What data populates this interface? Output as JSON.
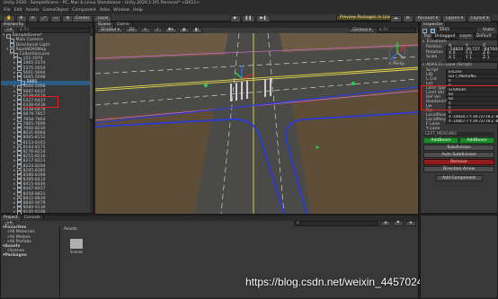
{
  "window": {
    "title": "Unity 2020 - SampleScene - PC, Mac & Linux Standalone - Unity 2020.1.0f1 Personal* <DX11>"
  },
  "menu": [
    "File",
    "Edit",
    "Assets",
    "GameObject",
    "Component",
    "Adas",
    "Window",
    "Help"
  ],
  "toolbar": {
    "pivot": "Center",
    "space": "Local",
    "preview_packages": "Preview Packages In Use",
    "account": "Account",
    "layers": "Layers",
    "layout": "Layout"
  },
  "hierarchy": {
    "tab": "Hierarchy",
    "search_placeholder": "All",
    "items": [
      {
        "label": "SampleScene*",
        "indent": 0,
        "open": true
      },
      {
        "label": "Main Camera",
        "indent": 1
      },
      {
        "label": "Directional Light",
        "indent": 1
      },
      {
        "label": "RoadADASMap",
        "indent": 1,
        "open": true
      },
      {
        "label": "CollectionLane",
        "indent": 2,
        "open": true
      },
      {
        "label": "151-1974",
        "indent": 3
      },
      {
        "label": "1965-5374",
        "indent": 3
      },
      {
        "label": "5375-5659",
        "indent": 3
      },
      {
        "label": "5661-5664",
        "indent": 3
      },
      {
        "label": "5665-5698",
        "indent": 3
      },
      {
        "label": "5665",
        "indent": 4,
        "selected": true
      },
      {
        "label": "5666-5668",
        "indent": 3
      },
      {
        "label": "5687-6037",
        "indent": 3
      },
      {
        "label": "6038-6426",
        "indent": 3
      },
      {
        "label": "6427-6437",
        "indent": 3
      },
      {
        "label": "6438-6438",
        "indent": 3
      },
      {
        "label": "6438-6878",
        "indent": 3
      },
      {
        "label": "6879-7857",
        "indent": 3
      },
      {
        "label": "7858-7864",
        "indent": 3
      },
      {
        "label": "7865-7899",
        "indent": 3
      },
      {
        "label": "7900-8030",
        "indent": 3
      },
      {
        "label": "8031-8064",
        "indent": 3
      },
      {
        "label": "8065-8152",
        "indent": 3
      },
      {
        "label": "8153-8163",
        "indent": 3
      },
      {
        "label": "8164-8175",
        "indent": 3
      },
      {
        "label": "8176-8214",
        "indent": 3
      },
      {
        "label": "8215-8216",
        "indent": 3
      },
      {
        "label": "8217-8223",
        "indent": 3
      },
      {
        "label": "8224-8294",
        "indent": 3
      },
      {
        "label": "8295-8385",
        "indent": 3
      },
      {
        "label": "8386-8398",
        "indent": 3
      },
      {
        "label": "8399-8414",
        "indent": 3
      },
      {
        "label": "8415-8446",
        "indent": 3
      },
      {
        "label": "8447-8457",
        "indent": 3
      },
      {
        "label": "8458-8821",
        "indent": 3
      },
      {
        "label": "8822-8839",
        "indent": 3
      },
      {
        "label": "8840-9079",
        "indent": 3
      },
      {
        "label": "9080-9139",
        "indent": 3
      },
      {
        "label": "9140-9198",
        "indent": 3
      }
    ]
  },
  "scene": {
    "tabs": [
      "Scene",
      "Game"
    ],
    "shading": "Shaded",
    "mode_2d": "2D",
    "gizmos": "Gizmos",
    "search_placeholder": "All",
    "projection": "< Persp"
  },
  "inspector": {
    "tab": "Inspector",
    "object_name": "5665",
    "static_label": "Static",
    "tag_label": "Tag",
    "tag_value": "Untagged",
    "layer_label": "Layer",
    "layer_value": "Default",
    "transform": {
      "title": "Transform",
      "rows": [
        {
          "label": "Position",
          "x": "-14820",
          "y": "39.7279",
          "z": "-84700"
        },
        {
          "label": "Rotation",
          "x": "0",
          "y": "0",
          "z": "0"
        },
        {
          "label": "Scale",
          "x": "1",
          "y": "1",
          "z": "1"
        }
      ]
    },
    "lane_component": {
      "title": "ADAS En Lane (Script)",
      "fields": [
        {
          "label": "Script",
          "value": "EnLane"
        },
        {
          "label": "LID",
          "value": "LEFT_MERGING"
        },
        {
          "label": "L Cnt",
          "value": "0"
        },
        {
          "label": "Lnt",
          "value": "0"
        },
        {
          "label": "Lane Type",
          "value": "STRAIGHT"
        },
        {
          "label": "Limit Vel",
          "value": "60"
        },
        {
          "label": "Ref Vel",
          "value": "60"
        },
        {
          "label": "Roadsecid",
          "value": "0"
        },
        {
          "label": "Lw",
          "value": "0"
        },
        {
          "label": "Rw",
          "value": "0"
        },
        {
          "label": "LocalPosx",
          "value": "X -14820.7   Y 39.72778   Z -84700.3"
        },
        {
          "label": "LocalPosy",
          "value": "X -14807.7   Y 39.72778   Z -84700.3"
        },
        {
          "label": "F Lane",
          "value": ""
        },
        {
          "label": "Y Lane",
          "value": ""
        }
      ],
      "list_header": "LEFT_MERGING",
      "buttons": {
        "left": "AddBeam",
        "right": "AddBeam",
        "subdivision": "Subdivision",
        "auto_subdivision": "Auto Subdivision",
        "delete": "Remove",
        "direction": "Direction Arrow"
      }
    },
    "add_component": "Add Component"
  },
  "project": {
    "tabs": [
      "Project",
      "Console"
    ],
    "tree": [
      {
        "label": "Favorites",
        "indent": 0,
        "bold": true
      },
      {
        "label": "All Materials",
        "indent": 1
      },
      {
        "label": "All Models",
        "indent": 1
      },
      {
        "label": "All Prefabs",
        "indent": 1
      },
      {
        "label": "Assets",
        "indent": 0,
        "bold": true
      },
      {
        "label": "Scenes",
        "indent": 1
      },
      {
        "label": "Packages",
        "indent": 0,
        "bold": true
      }
    ],
    "breadcrumb": "Assets",
    "folder": "Scenes"
  },
  "watermark": "https://blog.csdn.net/weixin_44570248",
  "colors": {
    "road": "#4a4a48",
    "lane_blue": "#2a3bd6",
    "lane_white": "#e8e8e8",
    "lane_yellow": "#e8d84a",
    "grass": "#6b5a3e",
    "selection": "#2c5d87",
    "highlight": "#e02020"
  }
}
